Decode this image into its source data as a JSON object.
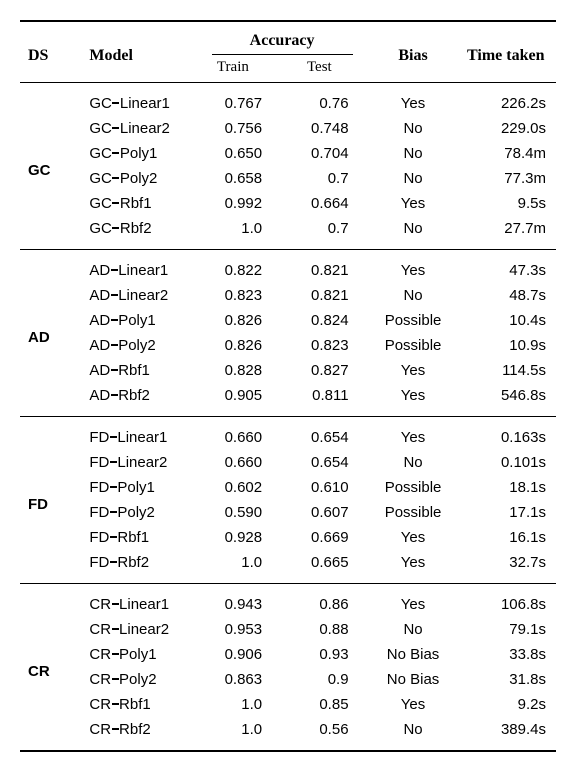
{
  "headers": {
    "ds": "DS",
    "model": "Model",
    "accuracy": "Accuracy",
    "train": "Train",
    "test": "Test",
    "bias": "Bias",
    "time": "Time taken"
  },
  "groups": [
    {
      "ds": "GC",
      "rows": [
        {
          "prefix": "GC",
          "suffix": "Linear1",
          "train": "0.767",
          "test": "0.76",
          "bias": "Yes",
          "time": "226.2s"
        },
        {
          "prefix": "GC",
          "suffix": "Linear2",
          "train": "0.756",
          "test": "0.748",
          "bias": "No",
          "time": "229.0s"
        },
        {
          "prefix": "GC",
          "suffix": "Poly1",
          "train": "0.650",
          "test": "0.704",
          "bias": "No",
          "time": "78.4m"
        },
        {
          "prefix": "GC",
          "suffix": "Poly2",
          "train": "0.658",
          "test": "0.7",
          "bias": "No",
          "time": "77.3m"
        },
        {
          "prefix": "GC",
          "suffix": "Rbf1",
          "train": "0.992",
          "test": "0.664",
          "bias": "Yes",
          "time": "9.5s"
        },
        {
          "prefix": "GC",
          "suffix": "Rbf2",
          "train": "1.0",
          "test": "0.7",
          "bias": "No",
          "time": "27.7m"
        }
      ]
    },
    {
      "ds": "AD",
      "rows": [
        {
          "prefix": "AD",
          "suffix": "Linear1",
          "train": "0.822",
          "test": "0.821",
          "bias": "Yes",
          "time": "47.3s"
        },
        {
          "prefix": "AD",
          "suffix": "Linear2",
          "train": "0.823",
          "test": "0.821",
          "bias": "No",
          "time": "48.7s"
        },
        {
          "prefix": "AD",
          "suffix": "Poly1",
          "train": "0.826",
          "test": "0.824",
          "bias": "Possible",
          "time": "10.4s"
        },
        {
          "prefix": "AD",
          "suffix": "Poly2",
          "train": "0.826",
          "test": "0.823",
          "bias": "Possible",
          "time": "10.9s"
        },
        {
          "prefix": "AD",
          "suffix": "Rbf1",
          "train": "0.828",
          "test": "0.827",
          "bias": "Yes",
          "time": "114.5s"
        },
        {
          "prefix": "AD",
          "suffix": "Rbf2",
          "train": "0.905",
          "test": "0.811",
          "bias": "Yes",
          "time": "546.8s"
        }
      ]
    },
    {
      "ds": "FD",
      "rows": [
        {
          "prefix": "FD",
          "suffix": "Linear1",
          "train": "0.660",
          "test": "0.654",
          "bias": "Yes",
          "time": "0.163s"
        },
        {
          "prefix": "FD",
          "suffix": "Linear2",
          "train": "0.660",
          "test": "0.654",
          "bias": "No",
          "time": "0.101s"
        },
        {
          "prefix": "FD",
          "suffix": "Poly1",
          "train": "0.602",
          "test": "0.610",
          "bias": "Possible",
          "time": "18.1s"
        },
        {
          "prefix": "FD",
          "suffix": "Poly2",
          "train": "0.590",
          "test": "0.607",
          "bias": "Possible",
          "time": "17.1s"
        },
        {
          "prefix": "FD",
          "suffix": "Rbf1",
          "train": "0.928",
          "test": "0.669",
          "bias": "Yes",
          "time": "16.1s"
        },
        {
          "prefix": "FD",
          "suffix": "Rbf2",
          "train": "1.0",
          "test": "0.665",
          "bias": "Yes",
          "time": "32.7s"
        }
      ]
    },
    {
      "ds": "CR",
      "rows": [
        {
          "prefix": "CR",
          "suffix": "Linear1",
          "train": "0.943",
          "test": "0.86",
          "bias": "Yes",
          "time": "106.8s"
        },
        {
          "prefix": "CR",
          "suffix": "Linear2",
          "train": "0.953",
          "test": "0.88",
          "bias": "No",
          "time": "79.1s"
        },
        {
          "prefix": "CR",
          "suffix": "Poly1",
          "train": "0.906",
          "test": "0.93",
          "bias": "No Bias",
          "time": "33.8s"
        },
        {
          "prefix": "CR",
          "suffix": "Poly2",
          "train": "0.863",
          "test": "0.9",
          "bias": "No Bias",
          "time": "31.8s"
        },
        {
          "prefix": "CR",
          "suffix": "Rbf1",
          "train": "1.0",
          "test": "0.85",
          "bias": "Yes",
          "time": "9.2s"
        },
        {
          "prefix": "CR",
          "suffix": "Rbf2",
          "train": "1.0",
          "test": "0.56",
          "bias": "No",
          "time": "389.4s"
        }
      ]
    }
  ]
}
